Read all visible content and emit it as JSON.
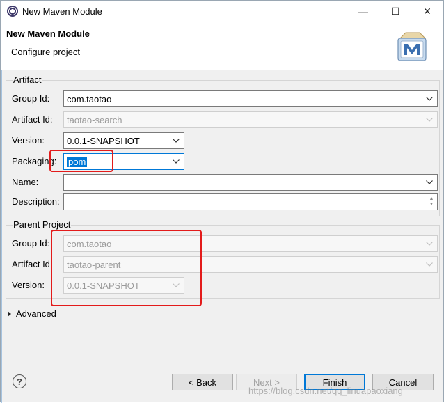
{
  "window": {
    "title": "New Maven Module",
    "minimize": "—",
    "maximize": "☐",
    "close": "✕"
  },
  "header": {
    "title": "New Maven Module",
    "subtitle": "Configure project"
  },
  "artifact": {
    "label": "Artifact",
    "group_id": {
      "label": "Group Id:",
      "value": "com.taotao"
    },
    "artifact_id": {
      "label": "Artifact Id:",
      "value": "taotao-search"
    },
    "version": {
      "label": "Version:",
      "value": "0.0.1-SNAPSHOT"
    },
    "packaging": {
      "label": "Packaging:",
      "value": "pom"
    },
    "name": {
      "label": "Name:",
      "value": ""
    },
    "description": {
      "label": "Description:",
      "value": ""
    }
  },
  "parent": {
    "label": "Parent Project",
    "group_id": {
      "label": "Group Id:",
      "value": "com.taotao"
    },
    "artifact_id": {
      "label": "Artifact Id:",
      "value": "taotao-parent"
    },
    "version": {
      "label": "Version:",
      "value": "0.0.1-SNAPSHOT"
    }
  },
  "advanced": {
    "label": "Advanced"
  },
  "buttons": {
    "back": "< Back",
    "next": "Next >",
    "finish": "Finish",
    "cancel": "Cancel"
  },
  "help": {
    "glyph": "?"
  },
  "watermark": "https://blog.csdn.net/qq_linuapaoxiang",
  "colors": {
    "highlight": "#e31b1b",
    "selection": "#0078d7"
  }
}
